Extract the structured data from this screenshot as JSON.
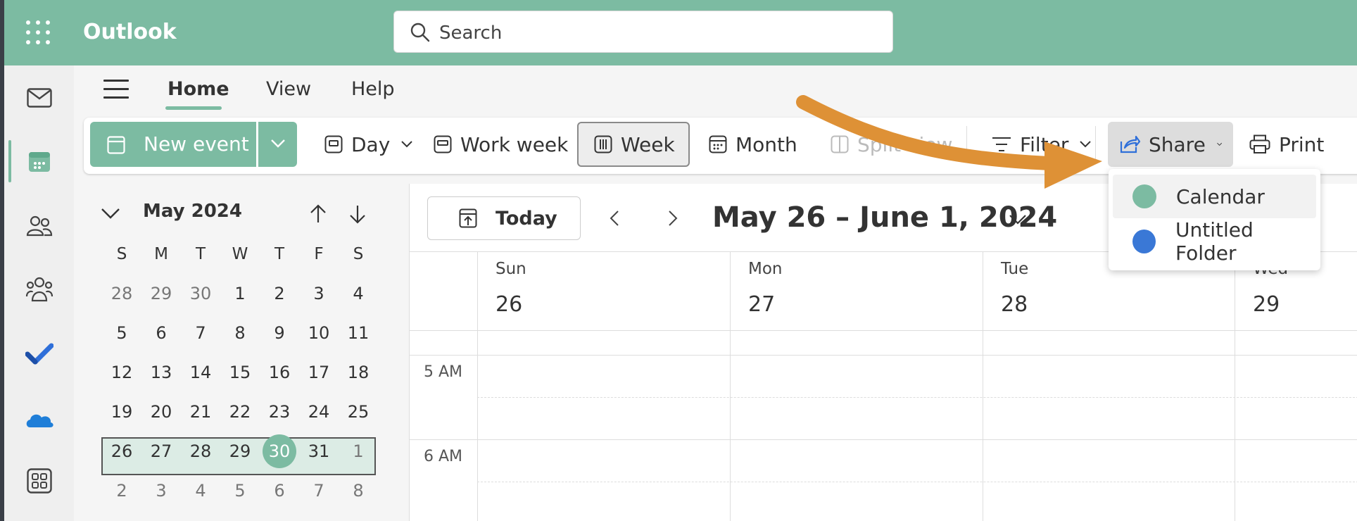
{
  "app": {
    "title": "Outlook"
  },
  "search": {
    "placeholder": "Search"
  },
  "ribbon": {
    "tabs": [
      {
        "label": "Home",
        "active": true
      },
      {
        "label": "View"
      },
      {
        "label": "Help"
      }
    ]
  },
  "toolbar": {
    "new_event_label": "New event",
    "day_label": "Day",
    "work_week_label": "Work week",
    "week_label": "Week",
    "month_label": "Month",
    "split_view_label": "Split view",
    "filter_label": "Filter",
    "share_label": "Share",
    "print_label": "Print"
  },
  "share_menu": {
    "items": [
      {
        "label": "Calendar",
        "color": "#7cbba2"
      },
      {
        "label": "Untitled Folder",
        "color": "#3a78d6"
      }
    ]
  },
  "mini_calendar": {
    "title": "May 2024",
    "weekday_headers": [
      "S",
      "M",
      "T",
      "W",
      "T",
      "F",
      "S"
    ],
    "weeks": [
      [
        "28",
        "29",
        "30",
        "1",
        "2",
        "3",
        "4"
      ],
      [
        "5",
        "6",
        "7",
        "8",
        "9",
        "10",
        "11"
      ],
      [
        "12",
        "13",
        "14",
        "15",
        "16",
        "17",
        "18"
      ],
      [
        "19",
        "20",
        "21",
        "22",
        "23",
        "24",
        "25"
      ],
      [
        "26",
        "27",
        "28",
        "29",
        "30",
        "31",
        "1"
      ],
      [
        "2",
        "3",
        "4",
        "5",
        "6",
        "7",
        "8"
      ]
    ],
    "today": "30"
  },
  "calendar": {
    "today_label": "Today",
    "range_title": "May 26 – June 1, 2024",
    "days": [
      {
        "name": "Sun",
        "num": "26"
      },
      {
        "name": "Mon",
        "num": "27"
      },
      {
        "name": "Tue",
        "num": "28"
      },
      {
        "name": "Wed",
        "num": "29"
      }
    ],
    "time_labels": [
      "5 AM",
      "6 AM"
    ]
  },
  "colors": {
    "accent": "#7cbba2",
    "arrow": "#de9136"
  }
}
